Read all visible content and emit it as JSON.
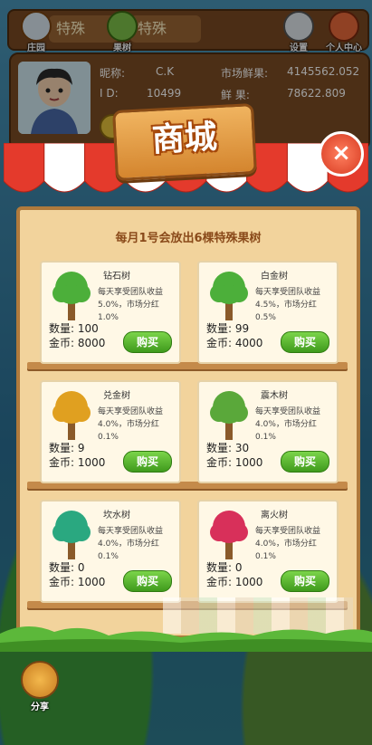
{
  "topbar": {
    "pill1": "特殊",
    "pill2": "特殊",
    "btn_home": "庄园",
    "btn_fruit": "果树",
    "btn_settings": "设置",
    "btn_profile": "个人中心"
  },
  "profile": {
    "nickname_label": "昵称:",
    "nickname": "C.K",
    "id_label": "I D:",
    "id": "10499",
    "market_label": "市场鲜果:",
    "market_value": "4145562.052",
    "fresh_label": "鲜  果:",
    "fresh_value": "78622.809"
  },
  "shop": {
    "title": "商城",
    "close": "×",
    "notice": "每月1号会放出6棵特殊果树",
    "qty_label": "数量:",
    "coin_label": "金币:",
    "buy_label": "购买",
    "items": [
      {
        "name": "钻石树",
        "desc": "每天享受团队收益5.0%，市场分红1.0%",
        "qty": "100",
        "coins": "8000",
        "color": "#4caf3a"
      },
      {
        "name": "白金树",
        "desc": "每天享受团队收益4.5%，市场分红0.5%",
        "qty": "99",
        "coins": "4000",
        "color": "#4caf3a"
      },
      {
        "name": "兑金树",
        "desc": "每天享受团队收益4.0%，市场分红0.1%",
        "qty": "9",
        "coins": "1000",
        "color": "#e0a020"
      },
      {
        "name": "震木树",
        "desc": "每天享受团队收益4.0%，市场分红0.1%",
        "qty": "30",
        "coins": "1000",
        "color": "#5aa83a"
      },
      {
        "name": "坎水树",
        "desc": "每天享受团队收益4.0%，市场分红0.1%",
        "qty": "0",
        "coins": "1000",
        "color": "#2aa880"
      },
      {
        "name": "离火树",
        "desc": "每天享受团队收益4.0%，市场分红0.1%",
        "qty": "0",
        "coins": "1000",
        "color": "#d8305a"
      }
    ]
  },
  "share_label": "分享"
}
